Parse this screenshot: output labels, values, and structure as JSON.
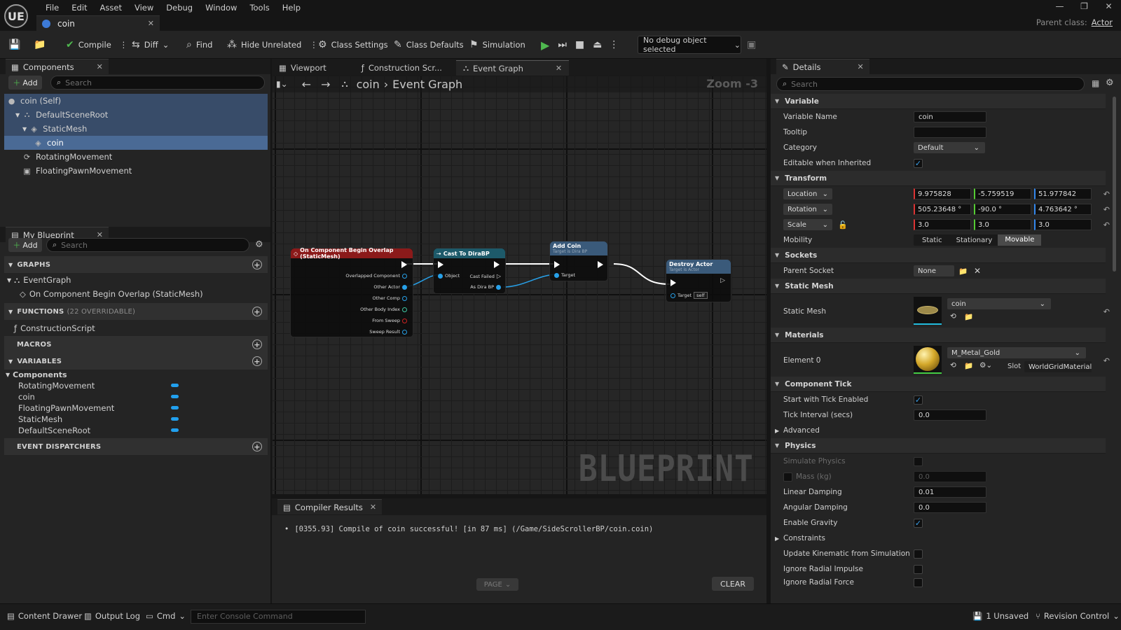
{
  "app": {
    "logo": "UE"
  },
  "menu": [
    "File",
    "Edit",
    "Asset",
    "View",
    "Debug",
    "Window",
    "Tools",
    "Help"
  ],
  "doc_tab": "coin",
  "parent_class": {
    "label": "Parent class:",
    "value": "Actor"
  },
  "toolbar": {
    "compile": "Compile",
    "diff": "Diff",
    "find": "Find",
    "hide_unrelated": "Hide Unrelated",
    "class_settings": "Class Settings",
    "class_defaults": "Class Defaults",
    "simulation": "Simulation",
    "debug_object": "No debug object selected"
  },
  "components": {
    "title": "Components",
    "add": "Add",
    "search_placeholder": "Search",
    "items": [
      "coin (Self)",
      "DefaultSceneRoot",
      "StaticMesh",
      "coin",
      "RotatingMovement",
      "FloatingPawnMovement"
    ]
  },
  "my_blueprint": {
    "title": "My Blueprint",
    "add": "Add",
    "search_placeholder": "Search",
    "graphs_label": "GRAPHS",
    "event_graph": "EventGraph",
    "event_node": "On Component Begin Overlap (StaticMesh)",
    "functions_label": "FUNCTIONS",
    "functions_count": "(22 OVERRIDABLE)",
    "construction_script": "ConstructionScript",
    "macros_label": "MACROS",
    "variables_label": "VARIABLES",
    "components_group": "Components",
    "variables": [
      "RotatingMovement",
      "coin",
      "FloatingPawnMovement",
      "StaticMesh",
      "DefaultSceneRoot"
    ],
    "dispatchers_label": "EVENT DISPATCHERS"
  },
  "graph_tabs": [
    "Viewport",
    "Construction Scr...",
    "Event Graph"
  ],
  "breadcrumb": {
    "root": "coin",
    "current": "Event Graph",
    "zoom": "Zoom -3"
  },
  "watermark": "BLUEPRINT",
  "nodes": {
    "overlap": {
      "title": "On Component Begin Overlap (StaticMesh)",
      "pins": [
        "Overlapped Component",
        "Other Actor",
        "Other Comp",
        "Other Body Index",
        "From Sweep",
        "Sweep Result"
      ]
    },
    "cast": {
      "title": "Cast To DiraBP",
      "pins": [
        "Object",
        "Cast Failed",
        "As Dira BP"
      ]
    },
    "addcoin": {
      "title": "Add Coin",
      "subtitle": "Target is Dira BP",
      "pins": [
        "Target"
      ]
    },
    "destroy": {
      "title": "Destroy Actor",
      "subtitle": "Target is Actor",
      "pin": "Target",
      "self": "self"
    }
  },
  "compiler": {
    "title": "Compiler Results",
    "message": "[0355.93] Compile of coin successful! [in 87 ms] (/Game/SideScrollerBP/coin.coin)",
    "page": "PAGE",
    "clear": "CLEAR"
  },
  "details": {
    "title": "Details",
    "search_placeholder": "Search",
    "variable": {
      "section": "Variable",
      "name_label": "Variable Name",
      "name": "coin",
      "tooltip_label": "Tooltip",
      "category_label": "Category",
      "category": "Default",
      "editable_label": "Editable when Inherited"
    },
    "transform": {
      "section": "Transform",
      "location_label": "Location",
      "location": [
        "9.975828",
        "-5.759519",
        "51.977842"
      ],
      "rotation_label": "Rotation",
      "rotation": [
        "505.23648 °",
        "-90.0 °",
        "4.763642 °"
      ],
      "scale_label": "Scale",
      "scale": [
        "3.0",
        "3.0",
        "3.0"
      ],
      "mobility_label": "Mobility",
      "mobility": [
        "Static",
        "Stationary",
        "Movable"
      ]
    },
    "sockets": {
      "section": "Sockets",
      "parent_label": "Parent Socket",
      "parent": "None"
    },
    "static_mesh": {
      "section": "Static Mesh",
      "label": "Static Mesh",
      "value": "coin"
    },
    "materials": {
      "section": "Materials",
      "label": "Element 0",
      "value": "M_Metal_Gold",
      "slot_label": "Slot",
      "slot": "WorldGridMaterial"
    },
    "tick": {
      "section": "Component Tick",
      "start_label": "Start with Tick Enabled",
      "interval_label": "Tick Interval (secs)",
      "interval": "0.0",
      "advanced": "Advanced"
    },
    "physics": {
      "section": "Physics",
      "simulate_label": "Simulate Physics",
      "mass_label": "Mass (kg)",
      "mass": "0.0",
      "linear_label": "Linear Damping",
      "linear": "0.01",
      "angular_label": "Angular Damping",
      "angular": "0.0",
      "gravity_label": "Enable Gravity",
      "constraints": "Constraints",
      "kinematic_label": "Update Kinematic from Simulation",
      "radial_impulse_label": "Ignore Radial Impulse",
      "radial_force_label": "Ignore Radial Force"
    }
  },
  "status": {
    "content_drawer": "Content Drawer",
    "output_log": "Output Log",
    "cmd": "Cmd",
    "console_placeholder": "Enter Console Command",
    "unsaved": "1 Unsaved",
    "revision": "Revision Control"
  },
  "colors": {
    "accent": "#21a0ee",
    "selection": "#384c69",
    "play": "#4fb84f",
    "event_node": "#8b1a1a",
    "cast_node": "#1d5a6a",
    "func_node": "#3a5a7a"
  }
}
